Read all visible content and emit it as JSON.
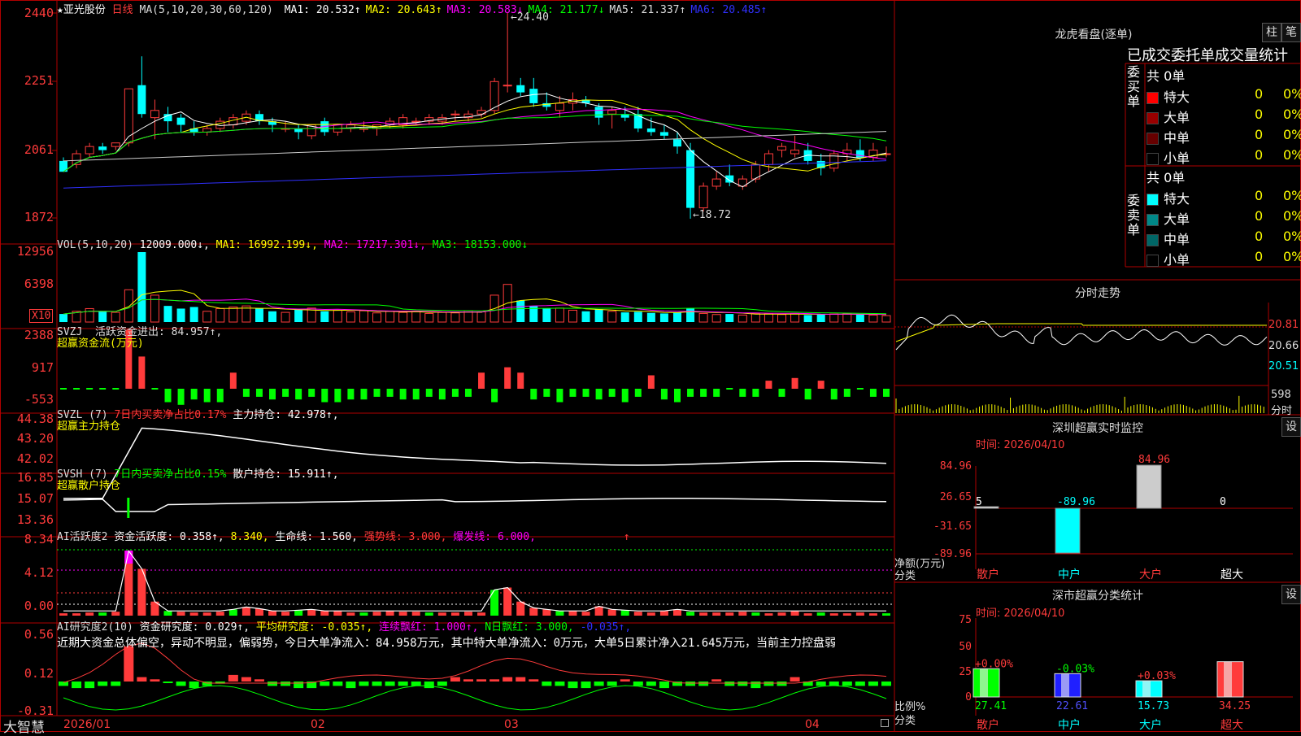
{
  "app": {
    "brand": "大智慧"
  },
  "stock": {
    "name": "亚光股份",
    "star": "★",
    "period": "日线"
  },
  "ma_legend": {
    "params": "MA(5,10,20,30,60,120)",
    "items": [
      {
        "label": "MA1: 20.532↑",
        "color": "#ffffff"
      },
      {
        "label": "MA2: 20.643↑",
        "color": "#ffff00"
      },
      {
        "label": "MA3: 20.583↓",
        "color": "#ff00ff"
      },
      {
        "label": "MA4: 21.177↓",
        "color": "#00ff00"
      },
      {
        "label": "MA5: 21.337↑",
        "color": "#dddddd"
      },
      {
        "label": "MA6: 20.485↑",
        "color": "#3030ff"
      }
    ]
  },
  "price_axis": [
    "2440",
    "2251",
    "2061",
    "1872"
  ],
  "price_marks": {
    "high": "24.40",
    "low": "18.72"
  },
  "vol": {
    "params": "VOL(5,10,20)",
    "value": "12009.000↓,",
    "ma1": "MA1: 16992.199↓,",
    "ma2": "MA2: 17217.301↓,",
    "ma3": "MA3: 18153.000↓",
    "axis": [
      "12956",
      "6398"
    ],
    "unit": "X10"
  },
  "svzj": {
    "name": "SVZJ",
    "text": "活跃资金进出: 84.957↑,",
    "sub": "超赢资金流(万元)",
    "axis": [
      "2388",
      "917",
      "-553"
    ]
  },
  "svzl": {
    "name": "SVZL (7)",
    "ratio": "7日内买卖净占比0.17%",
    "text": "主力持仓: 42.978↑,",
    "sub": "超赢主力持仓",
    "axis": [
      "44.38",
      "43.20",
      "42.02"
    ]
  },
  "svsh": {
    "name": "SVSH (7)",
    "ratio": "7日内买卖净占比0.15%",
    "text": "散户持仓: 15.911↑,",
    "sub": "超赢散户持仓",
    "axis": [
      "16.85",
      "15.07",
      "13.36"
    ]
  },
  "ai_active": {
    "name": "AI活跃度2",
    "text": "资金活跃度: 0.358↑,",
    "v2": "8.340,",
    "life": "生命线: 1.560,",
    "strong": "强势线: 3.000,",
    "burst": "爆发线: 6.000,",
    "arrow": "↑",
    "axis": [
      "8.34",
      "4.12",
      "0.00"
    ]
  },
  "ai_research": {
    "name": "AI研究度2(10)",
    "text": "资金研究度: 0.029↑,",
    "avg": "平均研究度: -0.035↑,",
    "red": "连续飘红: 1.000↑,",
    "nred": "N日飘红: 3.000,",
    "last": "-0.035↑,",
    "summary": "近期大资金总体偏空，异动不明显，偏弱势，今日大单净流入：84.958万元，其中特大单净流入：0万元，大单5日累计净入21.645万元，当前主力控盘弱",
    "axis": [
      "0.56",
      "0.12",
      "-0.31"
    ]
  },
  "date_axis": [
    "2026/01",
    "02",
    "03",
    "04"
  ],
  "side": {
    "lhb_title": "龙虎看盘(逐单)",
    "btn_zhu": "柱",
    "btn_bi": "笔",
    "stat_title": "已成交委托单成交量统计",
    "buy_label": "委买单",
    "sell_label": "委卖单",
    "buy_total": "共 0单",
    "sell_total": "共 0单",
    "buy_rows": [
      {
        "name": "特大",
        "count": "0",
        "pct": "0%",
        "color": "#ff0000"
      },
      {
        "name": "大单",
        "count": "0",
        "pct": "0%",
        "color": "#990000"
      },
      {
        "name": "中单",
        "count": "0",
        "pct": "0%",
        "color": "#660000"
      },
      {
        "name": "小单",
        "count": "0",
        "pct": "0%",
        "color": "#000000"
      }
    ],
    "sell_rows": [
      {
        "name": "特大",
        "count": "0",
        "pct": "0%",
        "color": "#00ffff"
      },
      {
        "name": "大单",
        "count": "0",
        "pct": "0%",
        "color": "#008888"
      },
      {
        "name": "中单",
        "count": "0",
        "pct": "0%",
        "color": "#006666"
      },
      {
        "name": "小单",
        "count": "0",
        "pct": "0%",
        "color": "#000000"
      }
    ],
    "intraday_title": "分时走势",
    "intraday_axis": [
      "20.81",
      "20.66",
      "20.51"
    ],
    "intraday_vol": "598",
    "intraday_unit": "分时",
    "monitor_title": "深圳超赢实时监控",
    "monitor_btn": "设",
    "monitor_time": "时间: 2026/04/10",
    "monitor_axis": [
      "84.96",
      "26.65",
      "-31.65",
      "-89.96"
    ],
    "monitor_ylabel": "净额(万元)",
    "monitor_xlabel": "分类",
    "monitor_cats": [
      "散户",
      "中户",
      "大户",
      "超大"
    ],
    "monitor_values": [
      "5",
      "-89.96",
      "84.96",
      "0"
    ],
    "class_title": "深市超赢分类统计",
    "class_btn": "设",
    "class_time": "时间: 2026/04/10",
    "class_axis": [
      "75",
      "50",
      "25",
      "0"
    ],
    "class_ylabel": "比例%",
    "class_xlabel": "分类",
    "class_cats": [
      "散户",
      "中户",
      "大户",
      "超大"
    ],
    "class_pcts": [
      "+0.00%",
      "-0.03%",
      "+0.03%",
      ""
    ],
    "class_values": [
      "27.41",
      "22.61",
      "15.73",
      "34.25"
    ]
  },
  "chart_data": {
    "type": "candlestick",
    "ohlc": [
      [
        20.3,
        20.4,
        20.0,
        20.0
      ],
      [
        20.2,
        20.6,
        20.1,
        20.5
      ],
      [
        20.5,
        20.8,
        20.4,
        20.7
      ],
      [
        20.7,
        20.8,
        20.5,
        20.6
      ],
      [
        20.7,
        20.8,
        20.6,
        20.8
      ],
      [
        20.8,
        22.3,
        20.7,
        22.3
      ],
      [
        22.4,
        23.2,
        21.5,
        21.6
      ],
      [
        21.5,
        22.0,
        20.9,
        21.7
      ],
      [
        21.6,
        21.8,
        21.1,
        21.4
      ],
      [
        21.5,
        21.6,
        21.1,
        21.3
      ],
      [
        21.2,
        21.4,
        21.0,
        21.1
      ],
      [
        21.1,
        21.3,
        21.0,
        21.2
      ],
      [
        21.2,
        21.5,
        21.1,
        21.4
      ],
      [
        21.3,
        21.6,
        21.2,
        21.5
      ],
      [
        21.4,
        21.7,
        21.3,
        21.6
      ],
      [
        21.6,
        21.7,
        21.3,
        21.4
      ],
      [
        21.4,
        21.5,
        21.1,
        21.3
      ],
      [
        21.2,
        21.4,
        21.1,
        21.2
      ],
      [
        21.2,
        21.3,
        20.9,
        21.1
      ],
      [
        21.0,
        21.3,
        20.9,
        21.3
      ],
      [
        21.4,
        21.5,
        21.0,
        21.1
      ],
      [
        21.1,
        21.3,
        21.0,
        21.3
      ],
      [
        21.2,
        21.4,
        21.1,
        21.3
      ],
      [
        21.2,
        21.4,
        21.1,
        21.2
      ],
      [
        21.2,
        21.3,
        21.0,
        21.3
      ],
      [
        21.3,
        21.5,
        21.2,
        21.4
      ],
      [
        21.3,
        21.6,
        21.2,
        21.5
      ],
      [
        21.4,
        21.5,
        21.3,
        21.4
      ],
      [
        21.4,
        21.6,
        21.3,
        21.5
      ],
      [
        21.4,
        21.6,
        21.3,
        21.5
      ],
      [
        21.6,
        21.7,
        21.4,
        21.6
      ],
      [
        21.5,
        21.7,
        21.4,
        21.6
      ],
      [
        21.6,
        21.8,
        21.5,
        21.7
      ],
      [
        21.7,
        22.6,
        21.6,
        22.5
      ],
      [
        22.4,
        24.4,
        22.2,
        22.4
      ],
      [
        22.4,
        22.6,
        22.1,
        22.2
      ],
      [
        22.3,
        22.6,
        21.8,
        21.9
      ],
      [
        21.9,
        22.2,
        21.7,
        21.8
      ],
      [
        21.7,
        22.1,
        21.5,
        21.9
      ],
      [
        21.9,
        22.2,
        21.7,
        22.0
      ],
      [
        22.0,
        22.1,
        21.8,
        21.9
      ],
      [
        21.8,
        21.9,
        21.3,
        21.5
      ],
      [
        21.6,
        21.8,
        21.2,
        21.7
      ],
      [
        21.6,
        21.8,
        21.4,
        21.5
      ],
      [
        21.6,
        21.8,
        21.1,
        21.2
      ],
      [
        21.2,
        21.5,
        21.0,
        21.1
      ],
      [
        21.1,
        21.3,
        20.9,
        21.0
      ],
      [
        20.9,
        21.1,
        20.5,
        20.7
      ],
      [
        20.6,
        20.8,
        18.7,
        19.0
      ],
      [
        19.0,
        19.7,
        18.9,
        19.6
      ],
      [
        19.6,
        20.0,
        19.5,
        19.8
      ],
      [
        19.9,
        20.2,
        19.6,
        19.7
      ],
      [
        19.6,
        19.9,
        19.5,
        19.8
      ],
      [
        19.8,
        20.3,
        19.7,
        20.2
      ],
      [
        20.2,
        20.6,
        20.0,
        20.5
      ],
      [
        20.6,
        20.8,
        20.4,
        20.7
      ],
      [
        20.5,
        21.0,
        20.4,
        20.6
      ],
      [
        20.6,
        20.8,
        20.2,
        20.3
      ],
      [
        20.3,
        20.5,
        19.9,
        20.1
      ],
      [
        20.1,
        20.6,
        20.0,
        20.5
      ],
      [
        20.5,
        20.8,
        20.3,
        20.6
      ],
      [
        20.6,
        20.9,
        20.3,
        20.4
      ],
      [
        20.4,
        20.8,
        20.3,
        20.6
      ],
      [
        20.5,
        20.7,
        20.4,
        20.5
      ]
    ],
    "volume": [
      1.5,
      2.0,
      2.5,
      2.0,
      1.8,
      6.0,
      13.0,
      5.0,
      3.0,
      2.5,
      2.8,
      2.0,
      2.5,
      2.8,
      3.0,
      2.5,
      2.0,
      1.8,
      2.3,
      2.6,
      2.0,
      2.2,
      1.9,
      2.1,
      1.7,
      2.0,
      1.8,
      2.0,
      1.6,
      1.8,
      1.7,
      2.1,
      1.9,
      5.0,
      7.0,
      4.0,
      3.0,
      2.5,
      2.6,
      2.2,
      2.0,
      2.4,
      2.0,
      1.8,
      1.9,
      1.7,
      1.6,
      1.8,
      2.5,
      1.6,
      1.4,
      1.5,
      1.3,
      1.6,
      1.5,
      1.4,
      1.6,
      1.3,
      1.4,
      1.5,
      1.6,
      1.4,
      1.3,
      1.2
    ],
    "xlabel_ticks": [
      "2026/01",
      "02",
      "03",
      "04"
    ],
    "ylim": [
      18.72,
      24.4
    ]
  }
}
